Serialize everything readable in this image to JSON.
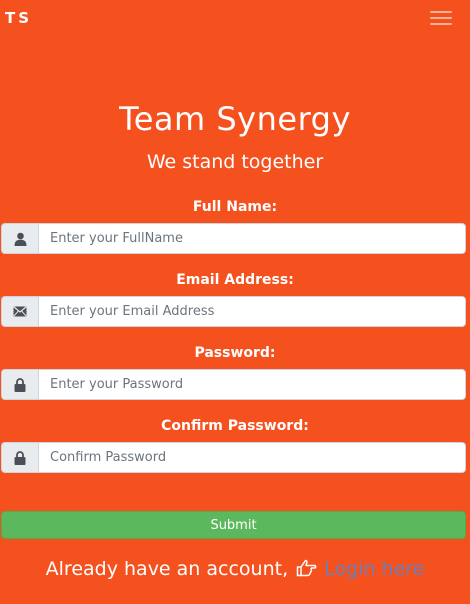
{
  "navbar": {
    "brand": "TS",
    "menu_icon": "hamburger-menu-icon"
  },
  "hero": {
    "title": "Team Synergy",
    "subtitle": "We stand together"
  },
  "form": {
    "fullname": {
      "label": "Full Name:",
      "placeholder": "Enter your FullName",
      "value": "",
      "icon": "user-icon"
    },
    "email": {
      "label": "Email Address:",
      "placeholder": "Enter your Email Address",
      "value": "",
      "icon": "envelope-icon"
    },
    "password": {
      "label": "Password:",
      "placeholder": "Enter your Password",
      "value": "",
      "icon": "lock-icon"
    },
    "confirm": {
      "label": "Confirm Password:",
      "placeholder": "Confirm Password",
      "value": "",
      "icon": "lock-icon"
    },
    "submit_label": "Submit"
  },
  "footer": {
    "prompt": "Already have an account,",
    "link_label": "Login here",
    "link_icon": "hand-pointing-icon"
  },
  "colors": {
    "background": "#f4511e",
    "submit": "#5cb85c",
    "link": "#6b7fb8"
  }
}
